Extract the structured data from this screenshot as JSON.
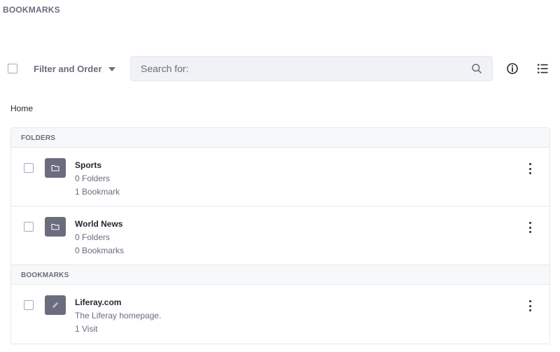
{
  "header": {
    "title": "BOOKMARKS"
  },
  "toolbar": {
    "filter_label": "Filter and Order",
    "search_placeholder": "Search for:"
  },
  "breadcrumb": {
    "current": "Home"
  },
  "groups": {
    "folders": {
      "header": "FOLDERS",
      "items": [
        {
          "title": "Sports",
          "line1": "0 Folders",
          "line2": "1 Bookmark",
          "icon": "folder-icon"
        },
        {
          "title": "World News",
          "line1": "0 Folders",
          "line2": "0 Bookmarks",
          "icon": "folder-icon"
        }
      ]
    },
    "bookmarks": {
      "header": "BOOKMARKS",
      "items": [
        {
          "title": "Liferay.com",
          "line1": "The Liferay homepage.",
          "line2": "1 Visit",
          "icon": "link-icon"
        }
      ]
    }
  },
  "colors": {
    "sticker": "#6b6c7e",
    "text": "#272833",
    "muted": "#6b6c7e",
    "border": "#e7e7ed",
    "search_bg": "#f1f2f5"
  }
}
